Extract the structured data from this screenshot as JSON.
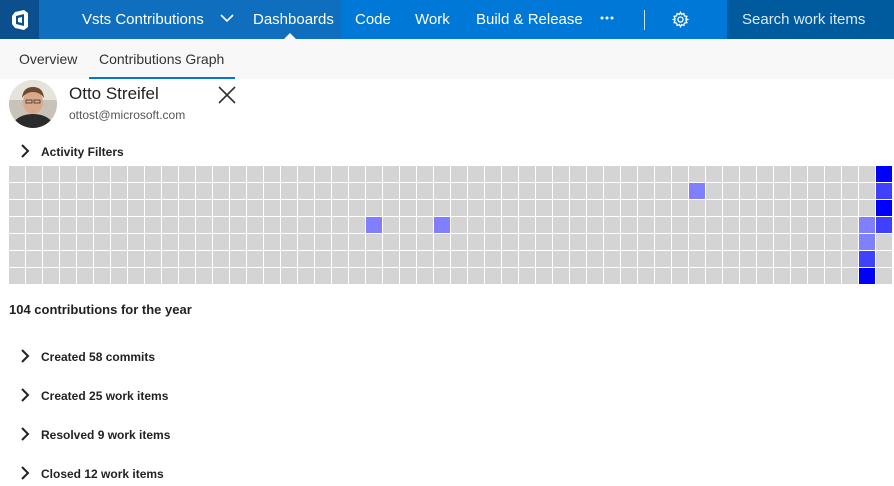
{
  "topnav": {
    "logo_icon": "vsts-logo-icon",
    "project_label": "Vsts Contributions",
    "items": [
      "Dashboards",
      "Code",
      "Work",
      "Build & Release"
    ],
    "active_item": "Dashboards",
    "more_icon": "more-icon",
    "settings_icon": "gear-icon",
    "search_placeholder": "Search work items"
  },
  "subnav": {
    "tabs": [
      "Overview",
      "Contributions Graph"
    ],
    "active_tab": "Contributions Graph"
  },
  "user": {
    "name": "Otto Streifel",
    "email": "ottost@microsoft.com"
  },
  "activity_filters_label": "Activity Filters",
  "contributions_graph": {
    "weeks": 52,
    "days_per_week": 7,
    "colors": {
      "none": "#d4d4d4",
      "low": "#8080ff",
      "medium": "#4040ff",
      "high": "#0000ff"
    },
    "active_cells": [
      {
        "week": 21,
        "day": 3,
        "level": "low"
      },
      {
        "week": 25,
        "day": 3,
        "level": "low"
      },
      {
        "week": 40,
        "day": 1,
        "level": "low"
      },
      {
        "week": 50,
        "day": 3,
        "level": "low"
      },
      {
        "week": 50,
        "day": 4,
        "level": "low"
      },
      {
        "week": 50,
        "day": 5,
        "level": "medium"
      },
      {
        "week": 50,
        "day": 6,
        "level": "high"
      },
      {
        "week": 51,
        "day": 0,
        "level": "high"
      },
      {
        "week": 51,
        "day": 1,
        "level": "medium"
      },
      {
        "week": 51,
        "day": 2,
        "level": "high"
      },
      {
        "week": 51,
        "day": 3,
        "level": "medium"
      }
    ]
  },
  "summary": "104 contributions for the year",
  "sections": [
    {
      "label": "Created 58 commits"
    },
    {
      "label": "Created 25 work items"
    },
    {
      "label": "Resolved 9 work items"
    },
    {
      "label": "Closed 12 work items"
    }
  ]
}
